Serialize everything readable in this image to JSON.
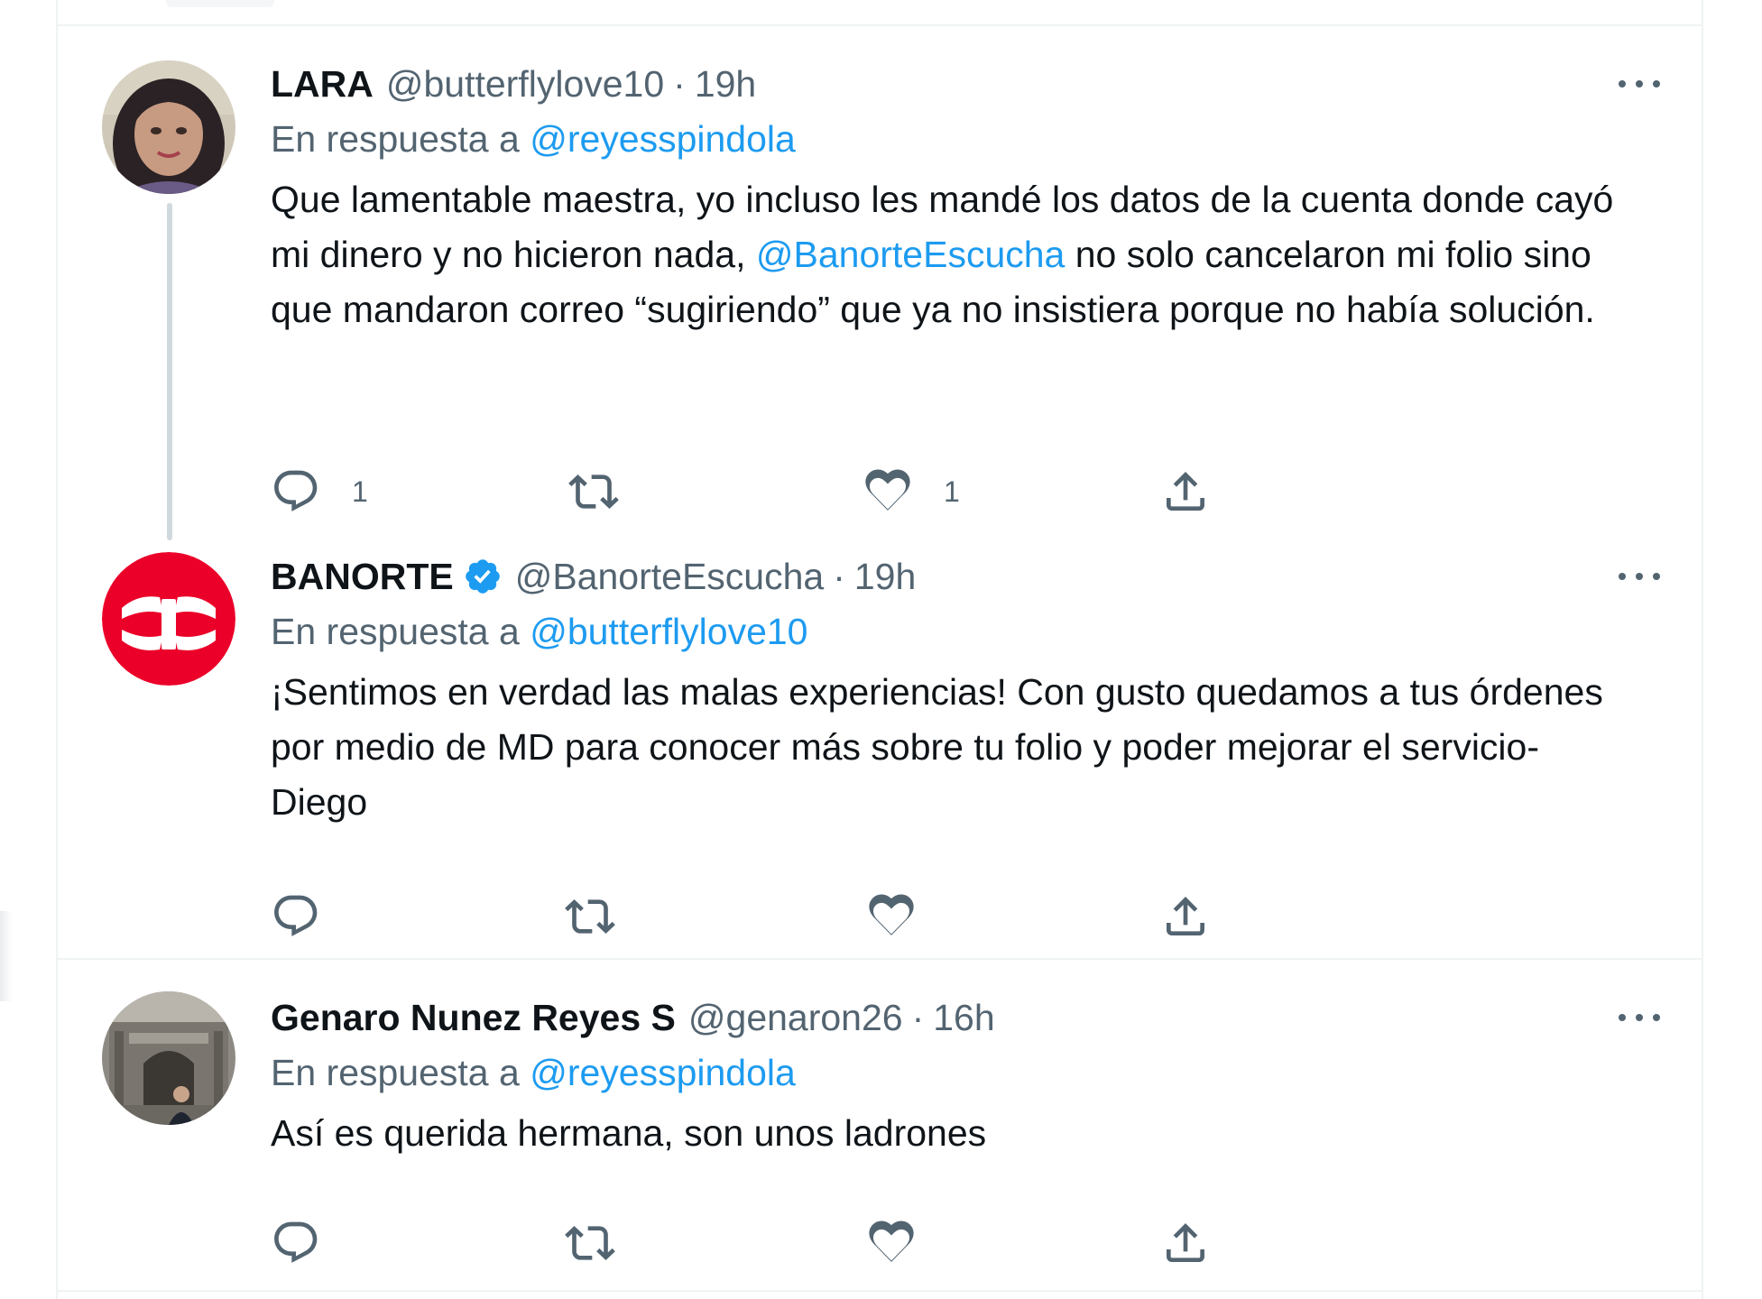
{
  "tweets": [
    {
      "display_name": "LARA",
      "handle": "@butterflylove10",
      "separator": "·",
      "time": "19h",
      "reply_prefix": "En respuesta a",
      "reply_to": "@reyesspindola",
      "text_before": "Que lamentable maestra, yo incluso les mandé los datos de la cuenta donde cayó mi dinero y no hicieron nada, ",
      "text_mention": "@BanorteEscucha",
      "text_after": " no solo cancelaron mi folio sino que mandaron correo “sugiriendo” que ya no insistiera porque no había solución.",
      "reply_count": "1",
      "retweet_count": "",
      "like_count": "1",
      "verified": false,
      "avatar_icon": "profile-photo-woman"
    },
    {
      "display_name": "BANORTE",
      "handle": "@BanorteEscucha",
      "separator": "·",
      "time": "19h",
      "reply_prefix": "En respuesta a",
      "reply_to": "@butterflylove10",
      "text_before": "¡Sentimos en verdad las malas experiencias! Con gusto quedamos a tus órdenes por medio de MD para conocer más sobre tu folio y poder mejorar el servicio- Diego",
      "text_mention": "",
      "text_after": "",
      "reply_count": "",
      "retweet_count": "",
      "like_count": "",
      "verified": true,
      "avatar_icon": "banorte-logo"
    },
    {
      "display_name": "Genaro Nunez Reyes S",
      "handle": "@genaron26",
      "separator": "·",
      "time": "16h",
      "reply_prefix": "En respuesta a",
      "reply_to": "@reyesspindola",
      "text_before": "Así es querida hermana, son unos ladrones",
      "text_mention": "",
      "text_after": "",
      "reply_count": "",
      "retweet_count": "",
      "like_count": "",
      "verified": false,
      "avatar_icon": "profile-photo-building"
    }
  ],
  "icons": {
    "reply": "reply-icon",
    "retweet": "retweet-icon",
    "like": "heart-icon",
    "share": "share-icon",
    "more": "more-icon",
    "verified": "verified-badge-icon"
  },
  "colors": {
    "link": "#1d9bf0",
    "secondary_text": "#536471",
    "banorte_red": "#eb0029",
    "thread_line": "#cfd9de"
  }
}
